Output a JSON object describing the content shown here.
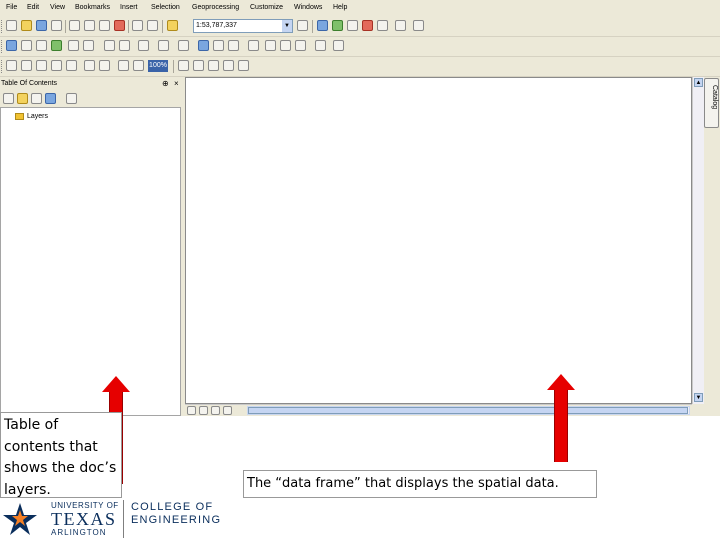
{
  "menu": [
    "File",
    "Edit",
    "View",
    "Bookmarks",
    "Insert",
    "Selection",
    "Geoprocessing",
    "Customize",
    "Windows",
    "Help"
  ],
  "toolbar": {
    "scale_value": "1:53,787,337",
    "zoom_value": "100%"
  },
  "toc": {
    "title": "Table Of Contents",
    "pin_icon": "pin-icon",
    "close_icon": "close-icon",
    "layers_label": "Layers"
  },
  "catalog_tab": {
    "label": "Catalog"
  },
  "captions": {
    "toc": "Table of contents that shows the doc’s layers.",
    "data_frame": "The “data frame” that displays the spatial data."
  },
  "logo": {
    "university_of": "UNIVERSITY OF",
    "texas": "TEXAS",
    "arlington": "ARLINGTON",
    "college_line1": "COLLEGE OF",
    "college_line2": "ENGINEERING"
  },
  "colors": {
    "arrow": "#e60000",
    "uta_blue": "#0a2e5c",
    "uta_orange": "#f58025"
  }
}
